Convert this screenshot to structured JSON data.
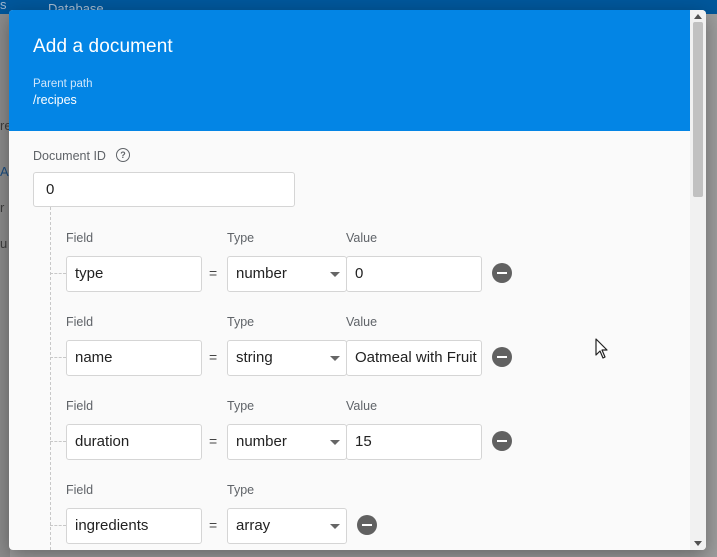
{
  "background": {
    "crumb": "s",
    "database_label": "Database",
    "side_fragments": [
      "re",
      "A",
      "r",
      "u"
    ]
  },
  "dialog": {
    "title": "Add a document",
    "parent_path_label": "Parent path",
    "parent_path_value": "/recipes",
    "document_id_label": "Document ID",
    "document_id_value": "0",
    "column_labels": {
      "field": "Field",
      "type": "Type",
      "value": "Value"
    },
    "fields": [
      {
        "field": "type",
        "type": "number",
        "value": "0"
      },
      {
        "field": "name",
        "type": "string",
        "value": "Oatmeal with Fruit"
      },
      {
        "field": "duration",
        "type": "number",
        "value": "15"
      },
      {
        "field": "ingredients",
        "type": "array"
      }
    ],
    "equals_sign": "="
  },
  "colors": {
    "header": "#0385e5",
    "remove_icon": "#616161"
  }
}
